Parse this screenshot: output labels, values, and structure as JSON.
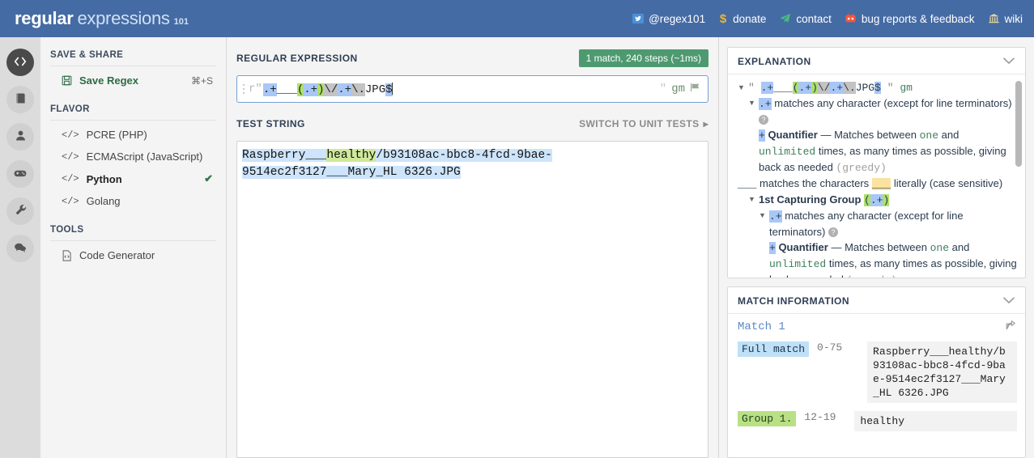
{
  "header": {
    "logo": {
      "part1": "regular",
      "part2": "expressions",
      "part3": "101"
    },
    "nav": [
      {
        "icon": "twitter-icon",
        "label": "@regex101"
      },
      {
        "icon": "dollar-icon",
        "label": "donate"
      },
      {
        "icon": "paper-plane-icon",
        "label": "contact"
      },
      {
        "icon": "gitlab-icon",
        "label": "bug reports & feedback"
      },
      {
        "icon": "bank-icon",
        "label": "wiki"
      }
    ],
    "accent_bg": "#456ba4"
  },
  "rail": {
    "items": [
      {
        "icon": "code-icon",
        "name": "regex-editor",
        "active": true
      },
      {
        "icon": "book-icon",
        "name": "library",
        "active": false
      },
      {
        "icon": "user-icon",
        "name": "account",
        "active": false
      },
      {
        "icon": "gamepad-icon",
        "name": "quiz",
        "active": false
      },
      {
        "icon": "wrench-icon",
        "name": "settings",
        "active": false
      },
      {
        "icon": "chat-icon",
        "name": "community",
        "active": false
      }
    ]
  },
  "sidebar": {
    "save_share_title": "SAVE & SHARE",
    "save_regex": {
      "label": "Save Regex",
      "shortcut": "⌘+S",
      "icon": "save-icon"
    },
    "flavor_title": "FLAVOR",
    "flavors": [
      {
        "label": "PCRE (PHP)",
        "selected": false
      },
      {
        "label": "ECMAScript (JavaScript)",
        "selected": false
      },
      {
        "label": "Python",
        "selected": true
      },
      {
        "label": "Golang",
        "selected": false
      }
    ],
    "tools_title": "TOOLS",
    "tools": [
      {
        "label": "Code Generator",
        "icon": "file-code-icon"
      }
    ]
  },
  "editor": {
    "regex_label": "REGULAR EXPRESSION",
    "match_badge": "1 match, 240 steps (~1ms)",
    "badge_color": "#4e9a70",
    "raw_prefix": "r\"",
    "regex_tokens": [
      {
        "text": ".+",
        "style": "blue"
      },
      {
        "text": "___",
        "style": "plain"
      },
      {
        "text": "(",
        "style": "green"
      },
      {
        "text": ".+",
        "style": "blue"
      },
      {
        "text": ")",
        "style": "green"
      },
      {
        "text": "\\/",
        "style": "gray"
      },
      {
        "text": ".+",
        "style": "blue"
      },
      {
        "text": "\\.",
        "style": "gray"
      },
      {
        "text": "JPG",
        "style": "plain"
      },
      {
        "text": "$",
        "style": "blue"
      }
    ],
    "regex_full": ".+___(.+)\\/.+\\.JPG$",
    "close_quote": "\"",
    "flags": "gm",
    "flag_icon": "flag-icon",
    "test_string_label": "TEST STRING",
    "switch_unit_tests": "SWITCH TO UNIT TESTS",
    "test_string": {
      "line1": [
        {
          "text": "Raspberry___",
          "style": "match"
        },
        {
          "text": "healthy",
          "style": "group"
        },
        {
          "text": "/b93108ac-bbc8-4fcd-9bae-",
          "style": "match"
        }
      ],
      "line2": [
        {
          "text": "9514ec2f3127___Mary_HL 6326.JPG",
          "style": "match"
        }
      ],
      "full": "Raspberry___healthy/b93108ac-bbc8-4fcd-9bae-9514ec2f3127___Mary_HL 6326.JPG"
    }
  },
  "explanation": {
    "title": "EXPLANATION",
    "header_regex": ".+___(.+)\\/.+\\.JPG$",
    "header_quote_open": "\"",
    "header_quote_close": "\"",
    "header_flags": "gm",
    "node1": {
      "token": ".+",
      "text": "matches any character (except for line terminators)"
    },
    "node1_quant": {
      "token": "+",
      "label": "Quantifier",
      "dash": "—",
      "text_a": "Matches between",
      "one": "one",
      "and": "and",
      "unlimited": "unlimited",
      "text_b": "times, as many times as possible, giving back as needed",
      "greedy": "(greedy)"
    },
    "literal_line": {
      "token": "___",
      "text_a": "matches the characters",
      "literal": "___",
      "text_b": "literally (case sensitive)"
    },
    "group_line": {
      "label": "1st Capturing Group",
      "token": "(.+)"
    },
    "node2": {
      "token": ".+",
      "text": "matches any character (except for line terminators)"
    },
    "node2_quant": {
      "token": "+",
      "label": "Quantifier",
      "dash": "—",
      "text_a": "Matches between",
      "one": "one",
      "and": "and",
      "unlimited": "unlimited",
      "text_b": "times, as many times as possible, giving back as needed",
      "greedy": "(greedy)"
    }
  },
  "match_information": {
    "title": "MATCH INFORMATION",
    "match_label": "Match 1",
    "share_icon": "share-icon",
    "rows": [
      {
        "tag": "Full match",
        "range": "0-75",
        "value": "Raspberry___healthy/b93108ac-bbc8-4fcd-9bae-9514ec2f3127___Mary_HL 6326.JPG",
        "kind": "full"
      },
      {
        "tag": "Group 1.",
        "range": "12-19",
        "value": "healthy",
        "kind": "group"
      }
    ]
  }
}
